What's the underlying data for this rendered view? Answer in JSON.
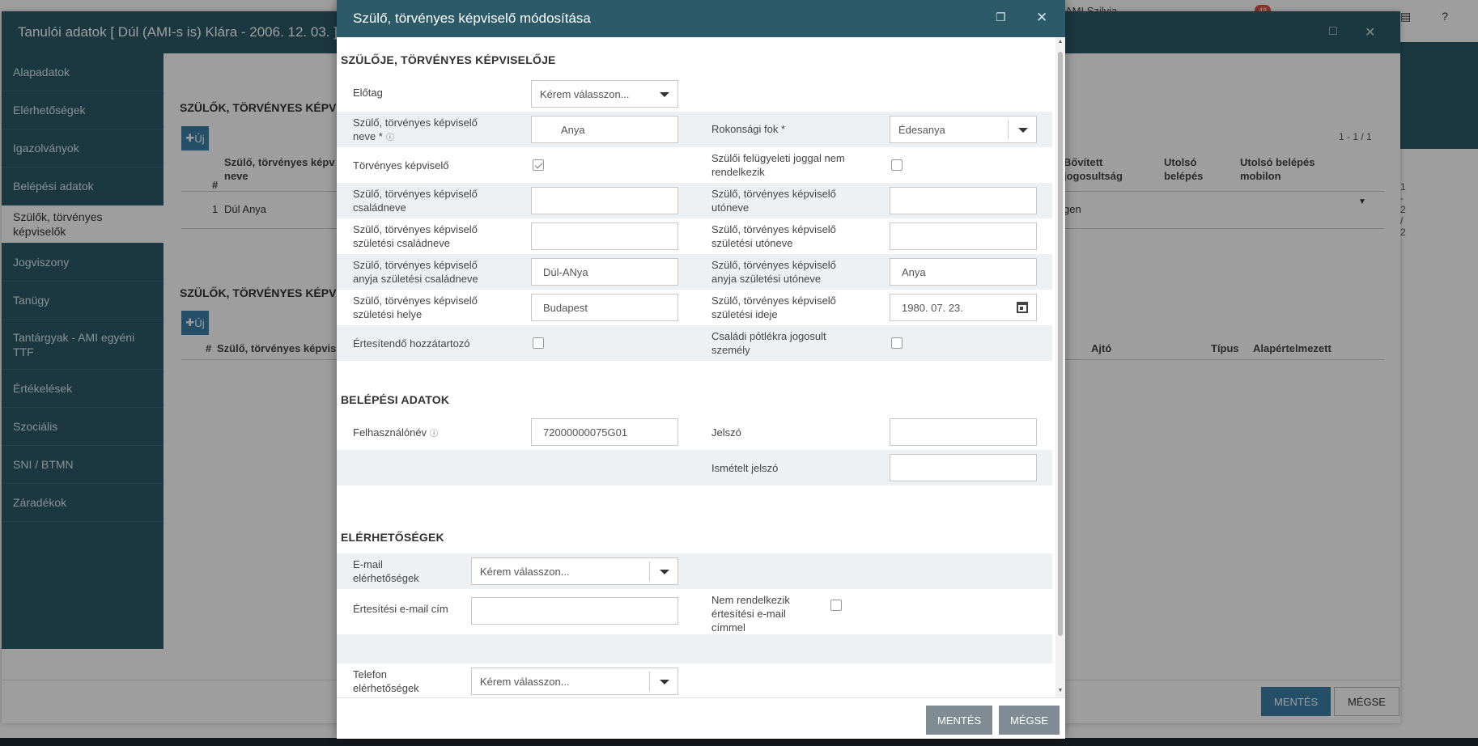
{
  "background": {
    "top_user": "AMI Szilvia",
    "top_badge": "48",
    "top_icons": [
      "book-icon",
      "help-icon"
    ],
    "window_title": "Tanulói adatok [ Dúl (AMI-s is) Klára - 2006. 12. 03. ]",
    "sidebar": [
      {
        "label": "Alapadatok"
      },
      {
        "label": "Elérhetőségek"
      },
      {
        "label": "Igazolványok"
      },
      {
        "label": "Belépési adatok"
      },
      {
        "label": "Szülők, törvényes képviselők"
      },
      {
        "label": "Jogviszony"
      },
      {
        "label": "Tanügy"
      },
      {
        "label": "Tantárgyak - AMI egyéni TTF"
      },
      {
        "label": "Értékelések"
      },
      {
        "label": "Szociális"
      },
      {
        "label": "SNI / BTMN"
      },
      {
        "label": "Záradékok"
      }
    ],
    "section1_title": "SZÜLŐK, TÖRVÉNYES KÉPVIS",
    "section2_title": "SZÜLŐK, TÖRVÉNYES KÉPVIS",
    "new_button": "Új",
    "pager1": "1 - 1 / 1",
    "pager2": "1 - 2 / 2",
    "table1_headers": {
      "num": "#",
      "name": "Szülő, törvényes képv neve",
      "bovitett": "Bővített jogosultság",
      "utolso": "Utolsó belépés",
      "utolso_mobil": "Utolsó belépés mobilon"
    },
    "table1_row": {
      "num": "1",
      "name": "Dúl Anya",
      "bovitett": "gen"
    },
    "table2_headers": {
      "num": "#",
      "name": "Szülő, törvényes képvis",
      "ajto": "Ajtó",
      "tipus": "Típus",
      "alap": "Alapértelmezett"
    },
    "footer_save": "MENTÉS",
    "footer_cancel": "MÉGSE"
  },
  "modal": {
    "title": "Szülő, törvényes képviselő módosítása",
    "section_parent": "SZÜLŐJE, TÖRVÉNYES KÉPVISELŐJE",
    "elotag_label": "Előtag",
    "elotag_value": "Kérem válasszon...",
    "name_label": "Szülő, törvényes képviselő neve *",
    "name_value": "Anya",
    "rokonsagi_label": "Rokonsági fok *",
    "rokonsagi_value": "Édesanya",
    "torvenyes_label": "Törvényes képviselő",
    "torvenyes_checked": true,
    "felugyeleti_label": "Szülői felügyeleti joggal nem rendelkezik",
    "felugyeleti_checked": false,
    "csaladnev_label": "Szülő, törvényes képviselő családneve",
    "csaladnev_value": "",
    "utonev_label": "Szülő, törvényes képviselő utóneve",
    "utonev_value": "",
    "szul_csaladnev_label": "Szülő, törvényes képviselő születési családneve",
    "szul_csaladnev_value": "",
    "szul_utonev_label": "Szülő, törvényes képviselő születési utóneve",
    "szul_utonev_value": "",
    "anyja_csaladnev_label": "Szülő, törvényes képviselő anyja születési családneve",
    "anyja_csaladnev_value": "Dúl-ANya",
    "anyja_utonev_label": "Szülő, törvényes képviselő anyja születési utóneve",
    "anyja_utonev_value": "Anya",
    "szul_hely_label": "Szülő, törvényes képviselő születési helye",
    "szul_hely_value": "Budapest",
    "szul_ido_label": "Szülő, törvényes képviselő születési ideje",
    "szul_ido_value": "1980. 07. 23.",
    "ertesitendo_label": "Értesítendő hozzátartozó",
    "ertesitendo_checked": false,
    "csaladi_label": "Családi pótlékra jogosult személy",
    "csaladi_checked": false,
    "section_login": "BELÉPÉSI ADATOK",
    "felhasznalo_label": "Felhasználónév",
    "felhasznalo_value": "72000000075G01",
    "jelszo_label": "Jelszó",
    "jelszo_value": "",
    "ismetelt_label": "Ismételt jelszó",
    "ismetelt_value": "",
    "section_contact": "ELÉRHETŐSÉGEK",
    "email_label": "E-mail elérhetőségek",
    "email_value": "Kérem válasszon...",
    "ertesitesi_email_label": "Értesítési e-mail cím",
    "ertesitesi_email_value": "",
    "nem_rendelkezik_label": "Nem rendelkezik értesítési e-mail címmel",
    "nem_rendelkezik_checked": false,
    "telefon_label": "Telefon elérhetőségek",
    "telefon_value": "Kérem válasszon...",
    "save_label": "MENTÉS",
    "cancel_label": "MÉGSE"
  }
}
